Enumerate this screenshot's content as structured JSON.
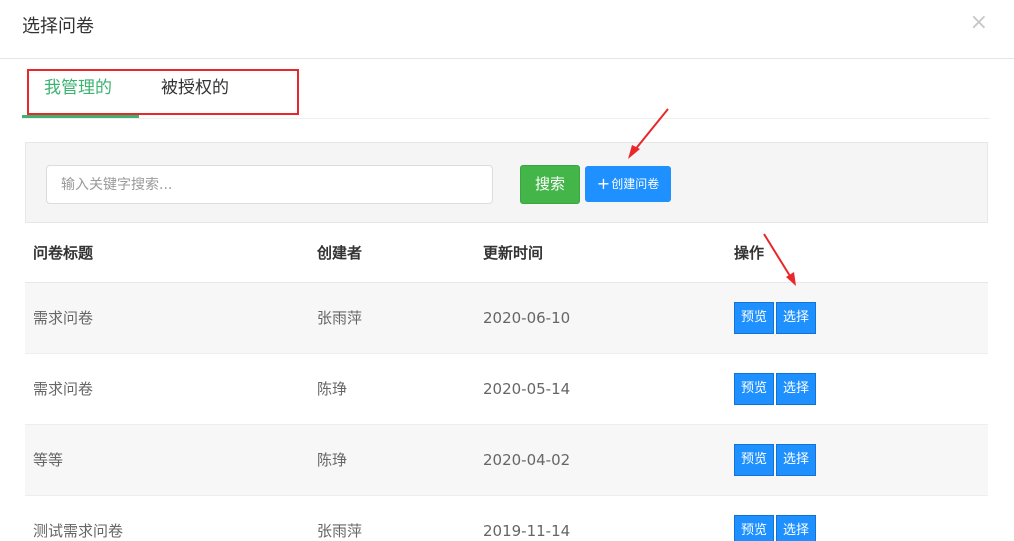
{
  "modal": {
    "title": "选择问卷",
    "close_label": "×"
  },
  "tabs": [
    {
      "label": "我管理的",
      "active": true
    },
    {
      "label": "被授权的",
      "active": false
    }
  ],
  "search": {
    "placeholder": "输入关键字搜索...",
    "button_label": "搜索"
  },
  "create_button": {
    "icon": "plus-icon",
    "label": "创建问卷"
  },
  "table": {
    "headers": [
      "问卷标题",
      "创建者",
      "更新时间",
      "操作"
    ],
    "rows": [
      {
        "title": "需求问卷",
        "creator": "张雨萍",
        "updated": "2020-06-10"
      },
      {
        "title": "需求问卷",
        "creator": "陈琤",
        "updated": "2020-05-14"
      },
      {
        "title": "等等",
        "creator": "陈琤",
        "updated": "2020-04-02"
      },
      {
        "title": "测试需求问卷",
        "creator": "张雨萍",
        "updated": "2019-11-14"
      }
    ],
    "actions": {
      "preview": "预览",
      "select": "选择"
    }
  },
  "colors": {
    "green": "#3cb371",
    "blue": "#1e90ff",
    "annotation_red": "#e8282b"
  }
}
